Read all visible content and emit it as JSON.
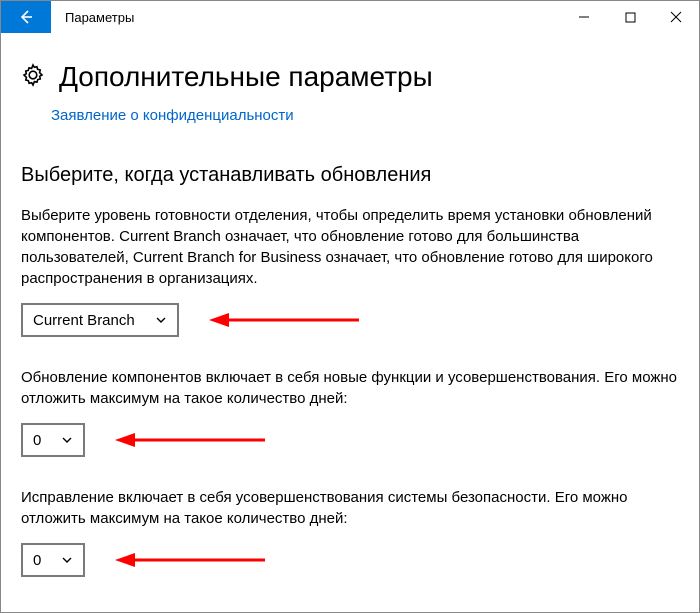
{
  "titlebar": {
    "title": "Параметры"
  },
  "page": {
    "heading": "Дополнительные параметры",
    "privacy_link": "Заявление о конфиденциальности"
  },
  "section": {
    "heading": "Выберите, когда устанавливать обновления",
    "branch_text": "Выберите уровень готовности отделения, чтобы определить время установки обновлений компонентов. Current Branch означает, что обновление готово для большинства пользователей, Current Branch for Business означает, что обновление готово для широкого распространения в организациях.",
    "branch_value": "Current Branch",
    "feature_text": "Обновление компонентов включает в себя новые функции и усовершенствования. Его можно отложить максимум на такое количество дней:",
    "feature_days": "0",
    "quality_text": "Исправление включает в себя усовершенствования системы безопасности. Его можно отложить максимум на такое количество дней:",
    "quality_days": "0"
  }
}
